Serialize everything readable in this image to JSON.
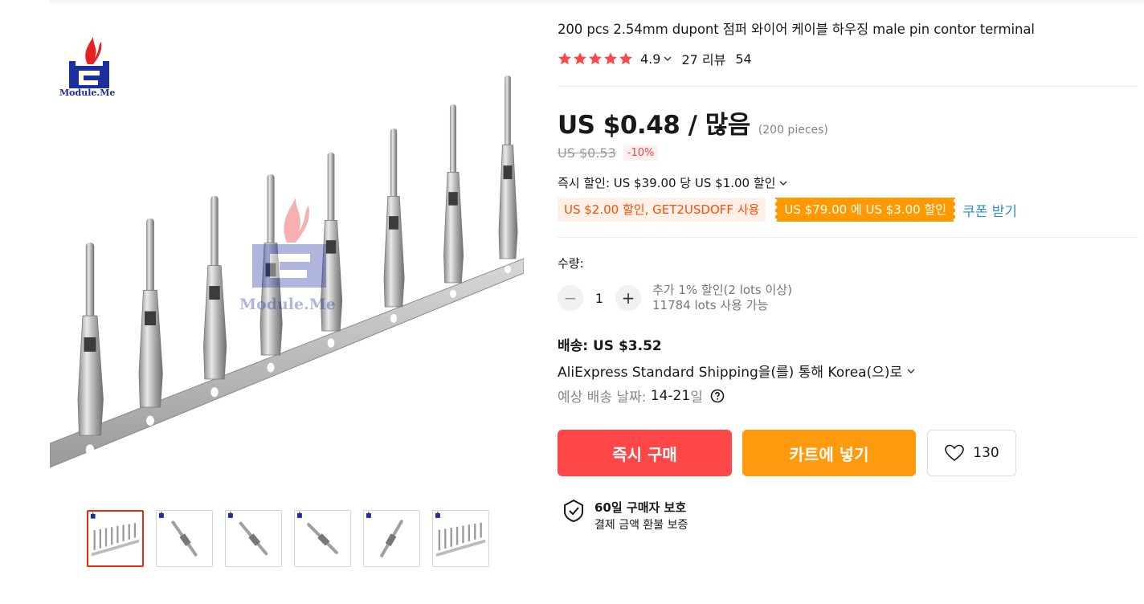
{
  "product": {
    "title": "200 pcs 2.54mm dupont 점퍼 와이어 케이블 하우징 male pin contor terminal",
    "rating": "4.9",
    "reviews": "27 리뷰",
    "orders": "54",
    "star_count": 5
  },
  "brand": {
    "watermark": "Module.Me"
  },
  "price": {
    "current": "US $0.48 / 많음",
    "pieces": "(200 pieces)",
    "original": "US $0.53",
    "discount": "-10%"
  },
  "promo": {
    "instant": "즉시 할인: US $39.00 당 US $1.00 할인",
    "coupon_code": "US $2.00 할인, GET2USDOFF 사용",
    "coupon_threshold": "US $79.00 에 US $3.00 할인",
    "get_coupon": "쿠폰 받기"
  },
  "quantity": {
    "label": "수량:",
    "value": "1",
    "minus": "−",
    "plus": "+",
    "note1": "추가 1% 할인(2 lots 이상)",
    "note2": "11784 lots 사용 가능"
  },
  "shipping": {
    "price": "배송: US $3.52",
    "method": "AliExpress Standard Shipping을(를) 통해 Korea(으)로",
    "date_label": "예상 배송 날짜:",
    "date_value": "14-21",
    "date_unit": "일"
  },
  "actions": {
    "buy": "즉시 구매",
    "cart": "카트에 넣기",
    "wishlist_count": "130"
  },
  "protection": {
    "title": "60일 구매자 보호",
    "subtitle": "결제 금액 환불 보증"
  },
  "colors": {
    "accent_red": "#ff4747",
    "accent_orange": "#ff9a0e",
    "star": "#ff4747",
    "link": "#2d8fc4"
  },
  "gallery": {
    "thumbnail_count": 6,
    "active_index": 0
  }
}
